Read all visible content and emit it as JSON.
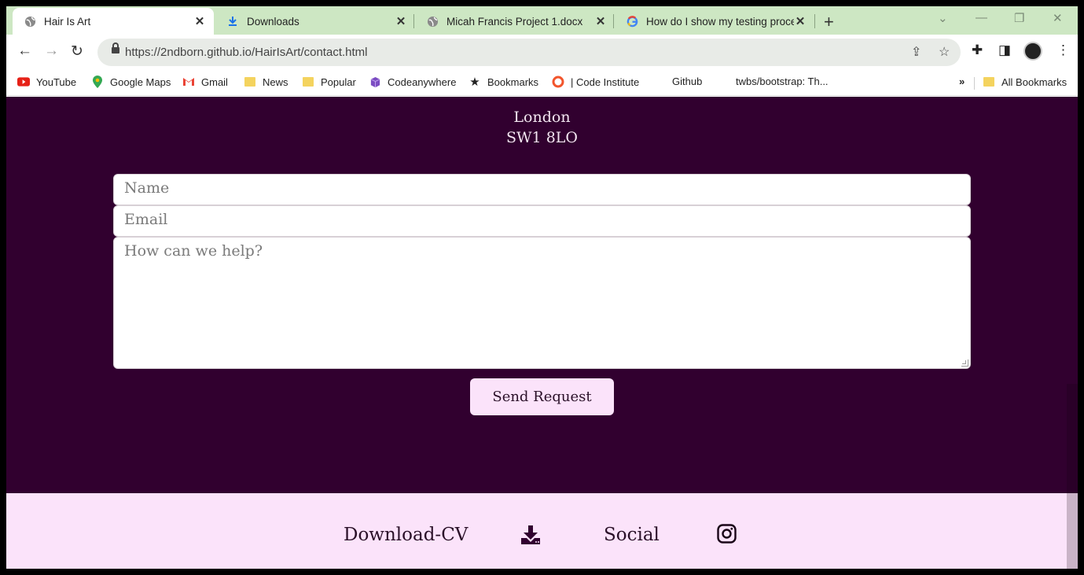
{
  "browser": {
    "tabs": [
      {
        "title": "Hair Is Art",
        "favicon": "globe-icon"
      },
      {
        "title": "Downloads",
        "favicon": "download-icon"
      },
      {
        "title": "Micah Francis Project 1.docx",
        "favicon": "globe-icon"
      },
      {
        "title": "How do I show my testing proce",
        "favicon": "google-icon"
      }
    ],
    "url": "https://2ndborn.github.io/HairIsArt/contact.html",
    "bookmarks": [
      {
        "label": "YouTube",
        "icon": "youtube-icon"
      },
      {
        "label": "Google Maps",
        "icon": "maps-pin-icon"
      },
      {
        "label": "Gmail",
        "icon": "gmail-icon"
      },
      {
        "label": "News",
        "icon": "folder-icon"
      },
      {
        "label": "Popular",
        "icon": "folder-icon"
      },
      {
        "label": "Codeanywhere",
        "icon": "cube-icon"
      },
      {
        "label": "Bookmarks",
        "icon": "star-icon"
      },
      {
        "label": "| Code Institute",
        "icon": "ring-icon"
      },
      {
        "label": "Github",
        "icon": "none"
      },
      {
        "label": "twbs/bootstrap: Th...",
        "icon": "none"
      }
    ],
    "bookmarks_overflow": "»",
    "all_bookmarks": "All Bookmarks"
  },
  "page": {
    "address_lines": [
      "London",
      "SW1 8LO"
    ],
    "form": {
      "name_placeholder": "Name",
      "email_placeholder": "Email",
      "message_placeholder": "How can we help?",
      "submit_label": "Send Request"
    },
    "footer": {
      "download_label": "Download-CV",
      "social_label": "Social"
    }
  },
  "colors": {
    "tabstrip": "#cde7c3",
    "page_bg": "#31002f",
    "footer_bg": "#fbe3fa",
    "button_bg": "#fbe3fa"
  }
}
